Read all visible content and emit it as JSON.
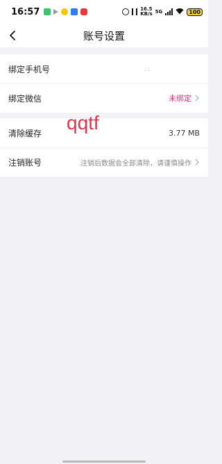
{
  "status_bar": {
    "time": "16:57",
    "speed_top": "16.5",
    "speed_bottom": "KB/s",
    "network": "5G",
    "battery": "100"
  },
  "nav": {
    "title": "账号设置"
  },
  "settings": {
    "bind_phone": {
      "label": "绑定手机号",
      "value": ".."
    },
    "bind_wechat": {
      "label": "绑定微信",
      "value": "未绑定"
    },
    "clear_cache": {
      "label": "清除缓存",
      "value": "3.77 MB"
    },
    "cancel_account": {
      "label": "注销账号",
      "value": "注销后数据会全部清除，请谨慎操作"
    }
  },
  "watermark": "qqtf",
  "colors": {
    "accent_pink": "#e02e86",
    "watermark_red": "#e5324a",
    "background": "#f2f2f6"
  }
}
